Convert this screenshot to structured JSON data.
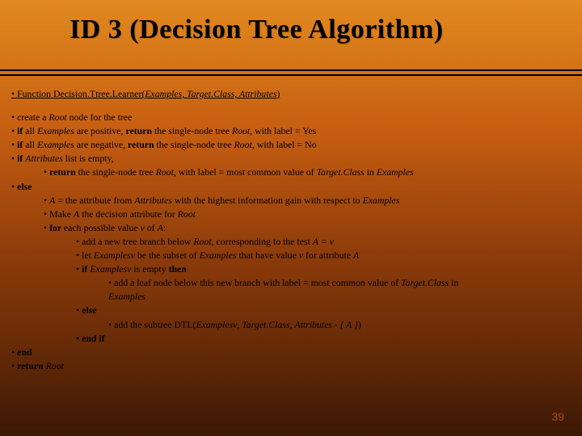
{
  "slide": {
    "title": "ID 3 (Decision Tree Algorithm)",
    "page_number": "39"
  },
  "lines": {
    "fn_prefix": "Function ",
    "fn_name": "Decision.Ttree.Learner(",
    "fn_args": "Examples, Target.Class, Attributes",
    "fn_close": ")",
    "l1_a": "create a ",
    "l1_b": "Root ",
    "l1_c": "node for the tree",
    "l2_a": "if ",
    "l2_b": "all ",
    "l2_c": "Examples",
    "l2_d": " are positive, ",
    "l2_e": "return ",
    "l2_f": "the single-node tree ",
    "l2_g": "Root",
    "l2_h": ", with label = Yes",
    "l3_a": "if ",
    "l3_b": "all ",
    "l3_c": "Examples",
    "l3_d": " are negative, ",
    "l3_e": "return ",
    "l3_f": "the single-node tree ",
    "l3_g": "Root",
    "l3_h": ", with label = No",
    "l4_a": "if ",
    "l4_b": "Attributes",
    "l4_c": " list is empty,",
    "l5_a": "return ",
    "l5_b": "the single-node tree ",
    "l5_c": "Root",
    "l5_d": ", with label = most common value of ",
    "l5_e": "Target.Class",
    "l5_f": " in ",
    "l5_g": "Examples",
    "l6_a": "else",
    "l7_a": "A",
    "l7_b": "  =  the attribute from ",
    "l7_c": "Attributes",
    "l7_d": " with the highest information gain with respect to ",
    "l7_e": "Examples",
    "l8_a": "Make ",
    "l8_b": "A",
    "l8_c": " the decision attribute for ",
    "l8_d": "Root",
    "l9_a": "for ",
    "l9_b": "each possible value ",
    "l9_c": "v",
    "l9_d": " of ",
    "l9_e": "A",
    "l9_f": ":",
    "l10_a": "add a new tree branch below ",
    "l10_b": "Root",
    "l10_c": ", corresponding to the test ",
    "l10_d": "A = v",
    "l11_a": "let ",
    "l11_b": "Examplesv",
    "l11_c": " be the subset of ",
    "l11_d": "Examples",
    "l11_e": " that have value ",
    "l11_f": "v",
    "l11_g": " for attribute ",
    "l11_h": "A",
    "l12_a": "if ",
    "l12_b": "Examplesv",
    "l12_c": " is empty ",
    "l12_d": "then",
    "l13_a": "add a leaf node below this new branch with label = most common value of ",
    "l13_b": "Target.Class",
    "l13_c": " in",
    "l13_d": "Examples",
    "l14_a": "else",
    "l15_a": "add the subtree DTL(",
    "l15_b": "Examplesv",
    "l15_c": ", ",
    "l15_d": "Target.Class",
    "l15_e": ", ",
    "l15_f": "Attributes - { A }",
    "l15_g": ")",
    "l16_a": "end if",
    "l17_a": "end",
    "l18_a": "return ",
    "l18_b": "Root"
  }
}
